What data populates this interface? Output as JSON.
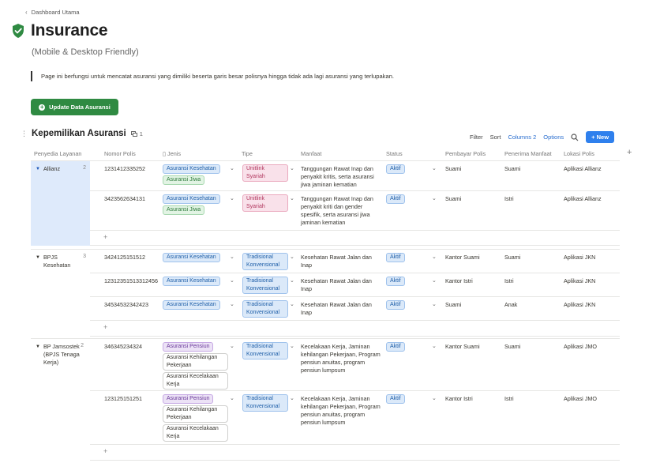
{
  "breadcrumb": "Dashboard Utama",
  "title": "Insurance",
  "subtitle": "(Mobile & Desktop Friendly)",
  "description": "Page ini berfungsi untuk mencatat asuransi yang dimiliki beserta garis besar polisnya hingga tidak ada lagi asuransi yang terlupakan.",
  "update_button": "Update Data Asuransi",
  "database": {
    "title": "Kepemilikan Asuransi",
    "linked_count": "1",
    "toolbar": {
      "filter": "Filter",
      "sort": "Sort",
      "columns": "Columns 2",
      "options": "Options",
      "new": "+ New"
    },
    "headers": [
      "Penyedia Layanan",
      "Nomor Polis",
      "Jenis",
      "Tipe",
      "Manfaat",
      "Status",
      "Pembayar Polis",
      "Penerima Manfaat",
      "Lokasi Polis"
    ],
    "add_column": "+",
    "add_row": "+",
    "groups": [
      {
        "name": "Allianz",
        "count": "2",
        "rows": [
          {
            "nomor": "1231412335252",
            "jenis": [
              "Asuransi Kesehatan",
              "Asuransi Jiwa"
            ],
            "tipe": [
              "Unitlink Syariah"
            ],
            "manfaat": "Tanggungan Rawat Inap dan penyakit kritis, serta asuransi jiwa jaminan kematian",
            "status": "Aktif",
            "pembayar": "Suami",
            "penerima": "Suami",
            "lokasi": "Aplikasi Allianz"
          },
          {
            "nomor": "3423562634131",
            "jenis": [
              "Asuransi Kesehatan",
              "Asuransi Jiwa"
            ],
            "tipe": [
              "Unitlink Syariah"
            ],
            "manfaat": "Tanggungan Rawat Inap dan penyakit kriti dan gender spesifik, serta asuransi jiwa jaminan kematian",
            "status": "Aktif",
            "pembayar": "Suami",
            "penerima": "Istri",
            "lokasi": "Aplikasi Allianz"
          }
        ]
      },
      {
        "name": "BPJS Kesehatan",
        "count": "3",
        "rows": [
          {
            "nomor": "3424125151512",
            "jenis": [
              "Asuransi Kesehatan"
            ],
            "tipe": [
              "Tradisional Konvensional"
            ],
            "manfaat": "Kesehatan Rawat Jalan dan Inap",
            "status": "Aktif",
            "pembayar": "Kantor Suami",
            "penerima": "Suami",
            "lokasi": "Aplikasi JKN"
          },
          {
            "nomor": "12312351513312456",
            "jenis": [
              "Asuransi Kesehatan"
            ],
            "tipe": [
              "Tradisional Konvensional"
            ],
            "manfaat": "Kesehatan Rawat Jalan dan Inap",
            "status": "Aktif",
            "pembayar": "Kantor Istri",
            "penerima": "Istri",
            "lokasi": "Aplikasi JKN"
          },
          {
            "nomor": "34534532342423",
            "jenis": [
              "Asuransi Kesehatan"
            ],
            "tipe": [
              "Tradisional Konvensional"
            ],
            "manfaat": "Kesehatan Rawat Jalan dan Inap",
            "status": "Aktif",
            "pembayar": "Suami",
            "penerima": "Anak",
            "lokasi": "Aplikasi JKN"
          }
        ]
      },
      {
        "name": "BP Jamsostek (BPJS Tenaga Kerja)",
        "count": "2",
        "rows": [
          {
            "nomor": "346345234324",
            "jenis": [
              "Asuransi Pensiun",
              "Asuransi Kehilangan Pekerjaan",
              "Asuransi Kecelakaan Kerja"
            ],
            "tipe": [
              "Tradisional Konvensional"
            ],
            "manfaat": "Kecelakaan Kerja, Jaminan kehilangan Pekerjaan, Program pensiun anuitas, program pensiun lumpsum",
            "status": "Aktif",
            "pembayar": "Kantor Suami",
            "penerima": "Suami",
            "lokasi": "Aplikasi JMO"
          },
          {
            "nomor": "123125151251",
            "jenis": [
              "Asuransi Pensiun",
              "Asuransi Kehilangan Pekerjaan",
              "Asuransi Kecelakaan Kerja"
            ],
            "tipe": [
              "Tradisional Konvensional"
            ],
            "manfaat": "Kecelakaan Kerja, Jaminan kehilangan Pekerjaan, Program pensiun anuitas, program pensiun lumpsum",
            "status": "Aktif",
            "pembayar": "Kantor Istri",
            "penerima": "Istri",
            "lokasi": "Aplikasi JMO"
          }
        ]
      }
    ]
  },
  "colors": {
    "accent_green": "#2f8a42",
    "accent_blue": "#2f80ed",
    "group_selected": "#deeafb"
  }
}
